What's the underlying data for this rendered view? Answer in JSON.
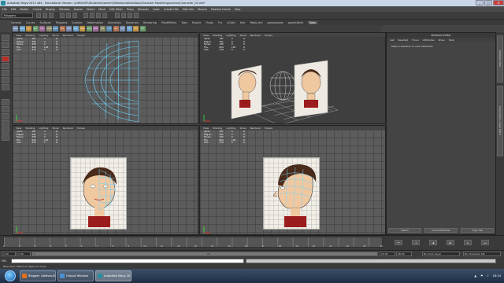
{
  "window": {
    "title": "Autodesk Maya 2013 x64 - Educational Version: \\\\cdfiler05\\Students\\home01\\Makeland\\Desktop\\Character Modelling\\scenes\\Character_02.mb*",
    "minimize": "_",
    "maximize": "□",
    "close": "✕"
  },
  "menubar": [
    "File",
    "Edit",
    "Modify",
    "Create",
    "Display",
    "Window",
    "Assets",
    "Select",
    "Mesh",
    "Edit Mesh",
    "Proxy",
    "Normals",
    "Color",
    "Create UVs",
    "Edit UVs",
    "Muscle",
    "Pipeline Cache",
    "Help"
  ],
  "mode_selector": "Polygons",
  "shelf_tabs": [
    "General",
    "Curves",
    "Surfaces",
    "Polygons",
    "Subdivs",
    "Deformation",
    "Animation",
    "Dynamics",
    "Rendering",
    "PaintEffects",
    "Toon",
    "Muscle",
    "Fluids",
    "Fur",
    "nCloth",
    "Hair",
    "Pablo_tim",
    "gameAssets",
    "gamesMeet",
    "Tools"
  ],
  "shelf_active": "Tools",
  "shelf_icons": [
    "cube",
    "sph",
    "cyl",
    "pln",
    "tor",
    "cone",
    "pipe",
    "hlx",
    "ext",
    "brg",
    "app",
    "mrg",
    "smt",
    "ins",
    "cut",
    "spl",
    "CP",
    "CF",
    "CO",
    "FC"
  ],
  "viewport_menu": [
    "View",
    "Shading",
    "Lighting",
    "Show",
    "Renderer",
    "Panels"
  ],
  "hud": {
    "rows": [
      {
        "label": "Verts:",
        "a": "187",
        "b": "0",
        "c": "0"
      },
      {
        "label": "Edges:",
        "a": "341",
        "b": "0",
        "c": "0"
      },
      {
        "label": "Faces:",
        "a": "155",
        "b": "0",
        "c": "0"
      },
      {
        "label": "Tris:",
        "a": "310",
        "b": "0",
        "c": "0"
      },
      {
        "label": "UVs:",
        "a": "209",
        "b": "0",
        "c": "0"
      }
    ]
  },
  "viewports": [
    {
      "name": "top-left",
      "hud": [
        [
          "Verts:",
          "187",
          "0",
          "0"
        ],
        [
          "Edges:",
          "341",
          "0",
          "0"
        ],
        [
          "Faces:",
          "155",
          "0",
          "0"
        ],
        [
          "Tris:",
          "624",
          "116",
          "0"
        ],
        [
          "UVs:",
          "579",
          "0",
          "0"
        ]
      ]
    },
    {
      "name": "top-right",
      "hud": [
        [
          "Verts:",
          "187",
          "0",
          "0"
        ],
        [
          "Edges:",
          "341",
          "0",
          "0"
        ],
        [
          "Faces:",
          "155",
          "0",
          "0"
        ],
        [
          "Tris:",
          "624",
          "116",
          "0"
        ],
        [
          "UVs:",
          "579",
          "0",
          "0"
        ]
      ]
    },
    {
      "name": "bottom-left",
      "hud": [
        [
          "Verts:",
          "187",
          "0",
          "0"
        ],
        [
          "Edges:",
          "341",
          "0",
          "0"
        ],
        [
          "Faces:",
          "155",
          "0",
          "0"
        ],
        [
          "Tris:",
          "624",
          "116",
          "0"
        ],
        [
          "UVs:",
          "579",
          "0",
          "0"
        ]
      ]
    },
    {
      "name": "bottom-right",
      "hud": [
        [
          "Verts:",
          "187",
          "0",
          "0"
        ],
        [
          "Edges:",
          "341",
          "0",
          "0"
        ],
        [
          "Faces:",
          "155",
          "0",
          "0"
        ],
        [
          "Tris:",
          "624",
          "116",
          "0"
        ],
        [
          "UVs:",
          "579",
          "0",
          "0"
        ]
      ]
    }
  ],
  "attribute_editor": {
    "title": "Attribute Editor",
    "menu": [
      "List",
      "Selected",
      "Focus",
      "Attributes",
      "Show",
      "Help"
    ],
    "message": "Make a selection to view attributes",
    "buttons": [
      "Select",
      "Load Attributes",
      "Copy Tab"
    ]
  },
  "side_tabs": [
    "Attribute Editor",
    "Channel Box / Layer Editor"
  ],
  "timeline": {
    "ticks": [
      "1",
      "2",
      "3",
      "4",
      "5",
      "6",
      "7",
      "8",
      "9",
      "10",
      "11",
      "12",
      "13",
      "14",
      "15",
      "16",
      "17",
      "18",
      "19",
      "20",
      "21",
      "22",
      "23",
      "24"
    ],
    "current": "1.00"
  },
  "range": {
    "start": "1.00",
    "start2": "1.00",
    "mid": "1",
    "end_inner": "24",
    "end": "24.00",
    "end2": "48.00",
    "anim_layer": "No Anim Layer",
    "char_set": "No Character Set"
  },
  "cmd": {
    "label": "MEL"
  },
  "help_line": "Move Tool: Select an object to move.",
  "taskbar": {
    "tasks": [
      {
        "label": "Blogger: Alethan-Bo...",
        "color": "#e07020"
      },
      {
        "label": "Output Window",
        "color": "#4a90d0"
      },
      {
        "label": "Autodesk Maya 2013...",
        "color": "#2a8c9c",
        "active": true
      }
    ],
    "clock": "18:24",
    "tray_icons": [
      "▲",
      "⚑",
      "♪"
    ]
  },
  "colors": {
    "accent": "#b83028",
    "wire": "#6fd4ff",
    "hud": "#ffffff"
  }
}
